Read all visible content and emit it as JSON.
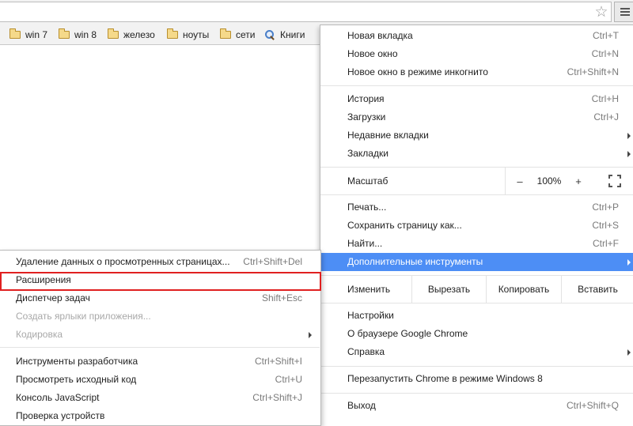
{
  "bookmarks": [
    "win 7",
    "win 8",
    "железо",
    "ноуты",
    "сети",
    "Книги"
  ],
  "menu": {
    "group1": [
      {
        "label": "Новая вкладка",
        "shortcut": "Ctrl+T"
      },
      {
        "label": "Новое окно",
        "shortcut": "Ctrl+N"
      },
      {
        "label": "Новое окно в режиме инкогнито",
        "shortcut": "Ctrl+Shift+N"
      }
    ],
    "group2": [
      {
        "label": "История",
        "shortcut": "Ctrl+H"
      },
      {
        "label": "Загрузки",
        "shortcut": "Ctrl+J"
      },
      {
        "label": "Недавние вкладки",
        "shortcut": ""
      },
      {
        "label": "Закладки",
        "shortcut": ""
      }
    ],
    "zoom": {
      "label": "Масштаб",
      "minus": "–",
      "value": "100%",
      "plus": "+"
    },
    "group3": [
      {
        "label": "Печать...",
        "shortcut": "Ctrl+P"
      },
      {
        "label": "Сохранить страницу как...",
        "shortcut": "Ctrl+S"
      },
      {
        "label": "Найти...",
        "shortcut": "Ctrl+F"
      },
      {
        "label": "Дополнительные инструменты",
        "shortcut": ""
      }
    ],
    "edit": {
      "label": "Изменить",
      "cut": "Вырезать",
      "copy": "Копировать",
      "paste": "Вставить"
    },
    "group4": [
      {
        "label": "Настройки"
      },
      {
        "label": "О браузере Google Chrome"
      },
      {
        "label": "Справка"
      }
    ],
    "relaunch": "Перезапустить Chrome в режиме Windows 8",
    "exit": {
      "label": "Выход",
      "shortcut": "Ctrl+Shift+Q"
    }
  },
  "submenu": {
    "group1": [
      {
        "label": "Удаление данных о просмотренных страницах...",
        "shortcut": "Ctrl+Shift+Del"
      },
      {
        "label": "Расширения",
        "shortcut": ""
      },
      {
        "label": "Диспетчер задач",
        "shortcut": "Shift+Esc"
      },
      {
        "label": "Создать ярлыки приложения...",
        "shortcut": ""
      },
      {
        "label": "Кодировка",
        "shortcut": ""
      }
    ],
    "group2": [
      {
        "label": "Инструменты разработчика",
        "shortcut": "Ctrl+Shift+I"
      },
      {
        "label": "Просмотреть исходный код",
        "shortcut": "Ctrl+U"
      },
      {
        "label": "Консоль JavaScript",
        "shortcut": "Ctrl+Shift+J"
      },
      {
        "label": "Проверка устройств",
        "shortcut": ""
      }
    ]
  },
  "colors": {
    "accent": "#4d8ef5",
    "highlight_border": "#e02020"
  }
}
